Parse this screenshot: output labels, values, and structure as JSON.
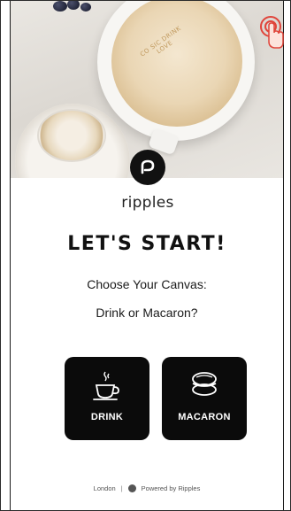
{
  "brand": {
    "name": "ripples",
    "icon": "ripples-logo-icon"
  },
  "hero": {
    "print_text": "CO SIC DRINK LOVE",
    "icon": "latte-photo"
  },
  "touch_icon": "tap-gesture-icon",
  "main": {
    "headline": "LET'S START!",
    "subtitle_line1": "Choose Your Canvas:",
    "subtitle_line2": "Drink or Macaron?"
  },
  "options": [
    {
      "label": "DRINK",
      "icon": "coffee-cup-icon"
    },
    {
      "label": "MACARON",
      "icon": "macaron-icon"
    }
  ],
  "footer": {
    "location": "London",
    "separator": "|",
    "powered_by": "Powered by Ripples",
    "icon": "ripples-mini-logo-icon"
  },
  "colors": {
    "primary": "#0b0b0b",
    "background": "#ffffff",
    "touch_accent": "#e0443a"
  }
}
